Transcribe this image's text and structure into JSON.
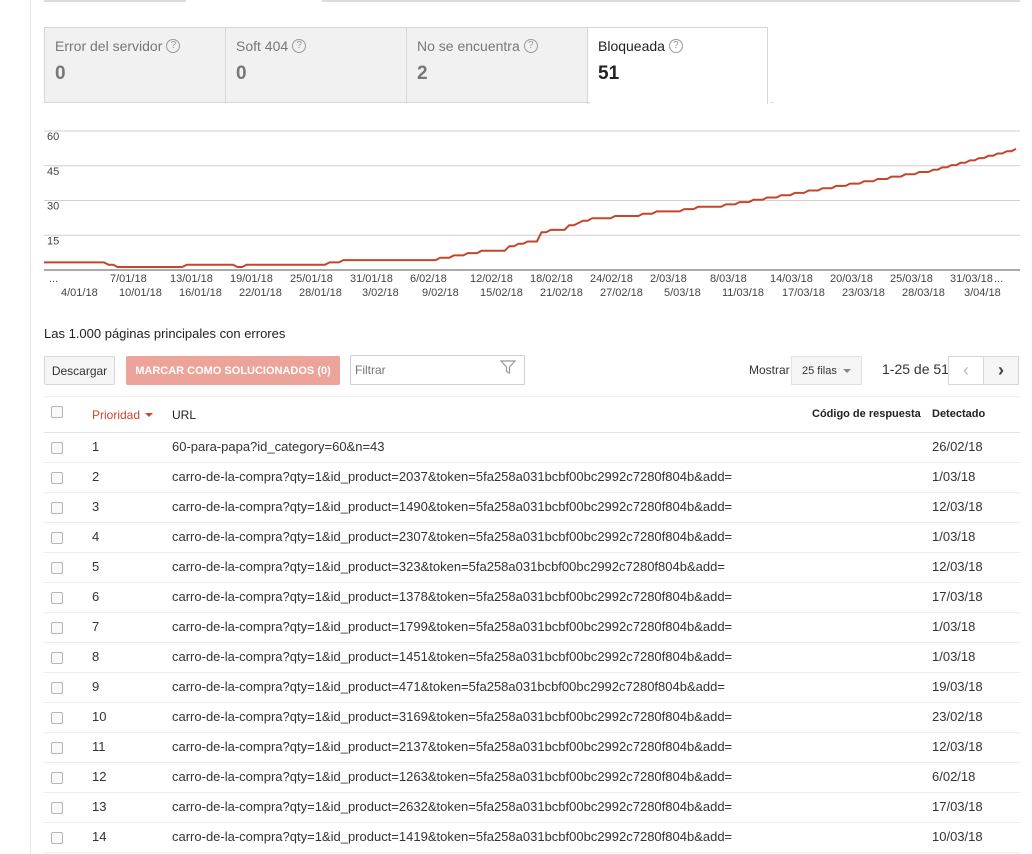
{
  "tabs": [
    {
      "label": "Error del servidor",
      "value": "0",
      "active": false
    },
    {
      "label": "Soft 404",
      "value": "0",
      "active": false
    },
    {
      "label": "No se encuentra",
      "value": "2",
      "active": false
    },
    {
      "label": "Bloqueada",
      "value": "51",
      "active": true
    }
  ],
  "help_symbol": "?",
  "chart_data": {
    "type": "line",
    "title": "",
    "xlabel": "",
    "ylabel": "",
    "ylim": [
      0,
      60
    ],
    "yticks": [
      "15",
      "30",
      "45",
      "60"
    ],
    "grid": true,
    "color": "#c5452b",
    "x_ticks_top": [
      "...",
      "7/01/18",
      "13/01/18",
      "19/01/18",
      "25/01/18",
      "31/01/18",
      "6/02/18",
      "12/02/18",
      "18/02/18",
      "24/02/18",
      "2/03/18",
      "8/03/18",
      "14/03/18",
      "20/03/18",
      "25/03/18",
      "31/03/18",
      "..."
    ],
    "x_ticks_bottom": [
      "4/01/18",
      "10/01/18",
      "16/01/18",
      "22/01/18",
      "28/01/18",
      "3/02/18",
      "9/02/18",
      "15/02/18",
      "21/02/18",
      "27/02/18",
      "5/03/18",
      "11/03/18",
      "17/03/18",
      "23/03/18",
      "28/03/18",
      "3/04/18"
    ],
    "series": [
      {
        "values": [
          2,
          2,
          2,
          2,
          2,
          2,
          2,
          2,
          2,
          2,
          2,
          2,
          2,
          2,
          1,
          1,
          0,
          0,
          0,
          0,
          0,
          0,
          0,
          0,
          0,
          0,
          0,
          0,
          0,
          0,
          0,
          1,
          1,
          1,
          1,
          1,
          1,
          1,
          1,
          1,
          1,
          1,
          0,
          0,
          1,
          1,
          1,
          1,
          1,
          1,
          1,
          1,
          1,
          1,
          1,
          1,
          1,
          1,
          1,
          1,
          1,
          1,
          2,
          2,
          2,
          3,
          3,
          3,
          3,
          3,
          3,
          3,
          3,
          3,
          3,
          3,
          3,
          3,
          3,
          3,
          3,
          3,
          3,
          3,
          3,
          3,
          4,
          4,
          4,
          5,
          5,
          5,
          6,
          6,
          6,
          7,
          7,
          7,
          7,
          7,
          7,
          9,
          9,
          10,
          10,
          11,
          11,
          11,
          15,
          15,
          16,
          16,
          16,
          16,
          18,
          18,
          19,
          20,
          20,
          21,
          21,
          21,
          21,
          21,
          22,
          22,
          22,
          22,
          22,
          22,
          23,
          23,
          23,
          24,
          24,
          24,
          24,
          24,
          24,
          25,
          25,
          25,
          26,
          26,
          26,
          26,
          26,
          26,
          27,
          27,
          27,
          28,
          28,
          28,
          29,
          29,
          29,
          30,
          30,
          30,
          31,
          31,
          31,
          32,
          32,
          32,
          33,
          33,
          33,
          34,
          34,
          34,
          35,
          35,
          35,
          36,
          36,
          36,
          37,
          37,
          37,
          38,
          38,
          38,
          39,
          39,
          39,
          40,
          40,
          40,
          41,
          41,
          41,
          42,
          42,
          43,
          43,
          44,
          44,
          45,
          45,
          46,
          46,
          47,
          47,
          48,
          48,
          49,
          49,
          50,
          50,
          51
        ]
      }
    ]
  },
  "section_title": "Las 1.000 páginas principales con errores",
  "toolbar": {
    "download_label": "Descargar",
    "mark_label": "MARCAR COMO SOLUCIONADOS (0)",
    "filter_placeholder": "Filtrar",
    "show_label": "Mostrar",
    "rows_select": "25 filas",
    "range": "1-25 de 51",
    "prev": "‹",
    "next": "›"
  },
  "table": {
    "headers": {
      "priority": "Prioridad",
      "url": "URL",
      "code": "Código de respuesta",
      "detected": "Detectado"
    },
    "rows": [
      {
        "priority": "1",
        "url": "60-para-papa?id_category=60&n=43",
        "detected": "26/02/18"
      },
      {
        "priority": "2",
        "url": "carro-de-la-compra?qty=1&id_product=2037&token=5fa258a031bcbf00bc2992c7280f804b&add=",
        "detected": "1/03/18"
      },
      {
        "priority": "3",
        "url": "carro-de-la-compra?qty=1&id_product=1490&token=5fa258a031bcbf00bc2992c7280f804b&add=",
        "detected": "12/03/18"
      },
      {
        "priority": "4",
        "url": "carro-de-la-compra?qty=1&id_product=2307&token=5fa258a031bcbf00bc2992c7280f804b&add=",
        "detected": "1/03/18"
      },
      {
        "priority": "5",
        "url": "carro-de-la-compra?qty=1&id_product=323&token=5fa258a031bcbf00bc2992c7280f804b&add=",
        "detected": "12/03/18"
      },
      {
        "priority": "6",
        "url": "carro-de-la-compra?qty=1&id_product=1378&token=5fa258a031bcbf00bc2992c7280f804b&add=",
        "detected": "17/03/18"
      },
      {
        "priority": "7",
        "url": "carro-de-la-compra?qty=1&id_product=1799&token=5fa258a031bcbf00bc2992c7280f804b&add=",
        "detected": "1/03/18"
      },
      {
        "priority": "8",
        "url": "carro-de-la-compra?qty=1&id_product=1451&token=5fa258a031bcbf00bc2992c7280f804b&add=",
        "detected": "1/03/18"
      },
      {
        "priority": "9",
        "url": "carro-de-la-compra?qty=1&id_product=471&token=5fa258a031bcbf00bc2992c7280f804b&add=",
        "detected": "19/03/18"
      },
      {
        "priority": "10",
        "url": "carro-de-la-compra?qty=1&id_product=3169&token=5fa258a031bcbf00bc2992c7280f804b&add=",
        "detected": "23/02/18"
      },
      {
        "priority": "11",
        "url": "carro-de-la-compra?qty=1&id_product=2137&token=5fa258a031bcbf00bc2992c7280f804b&add=",
        "detected": "12/03/18"
      },
      {
        "priority": "12",
        "url": "carro-de-la-compra?qty=1&id_product=1263&token=5fa258a031bcbf00bc2992c7280f804b&add=",
        "detected": "6/02/18"
      },
      {
        "priority": "13",
        "url": "carro-de-la-compra?qty=1&id_product=2632&token=5fa258a031bcbf00bc2992c7280f804b&add=",
        "detected": "17/03/18"
      },
      {
        "priority": "14",
        "url": "carro-de-la-compra?qty=1&id_product=1419&token=5fa258a031bcbf00bc2992c7280f804b&add=",
        "detected": "10/03/18"
      }
    ]
  }
}
